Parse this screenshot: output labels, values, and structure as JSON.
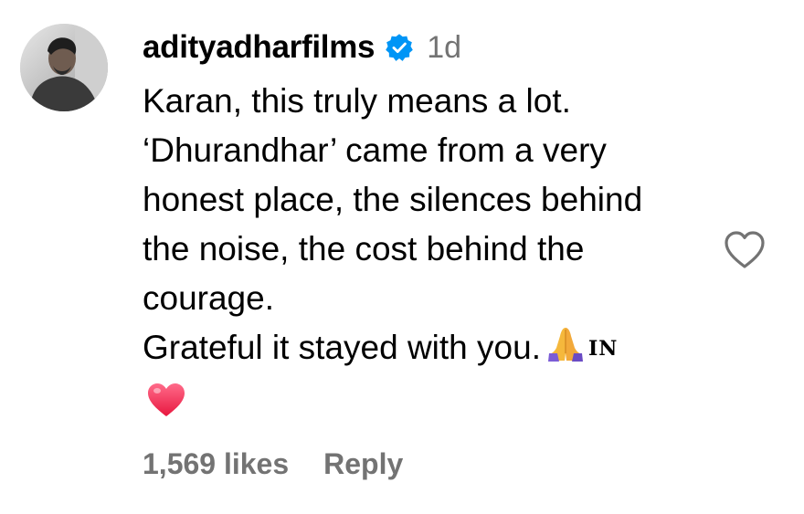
{
  "comment": {
    "username": "adityadharfilms",
    "timestamp": "1d",
    "verified_icon": "verified-badge-icon",
    "body_lines": [
      "Karan, this truly means a lot.",
      "‘Dhurandhar’ came from a very",
      "honest place, the silences behind",
      "the noise, the cost behind the",
      "courage.",
      "Grateful it stayed with you."
    ],
    "trailing_emoji": "folded-hands-emoji",
    "flag_text": "IN",
    "reaction_emoji": "red-heart-emoji",
    "likes": "1,569 likes",
    "reply_label": "Reply",
    "like_icon": "heart-outline-icon"
  },
  "colors": {
    "verified_blue": "#0095F6",
    "muted_text": "#737373",
    "heart_red": "#F0304F",
    "hands_purple": "#7B5CD6",
    "hands_yellow": "#F5B83C"
  }
}
